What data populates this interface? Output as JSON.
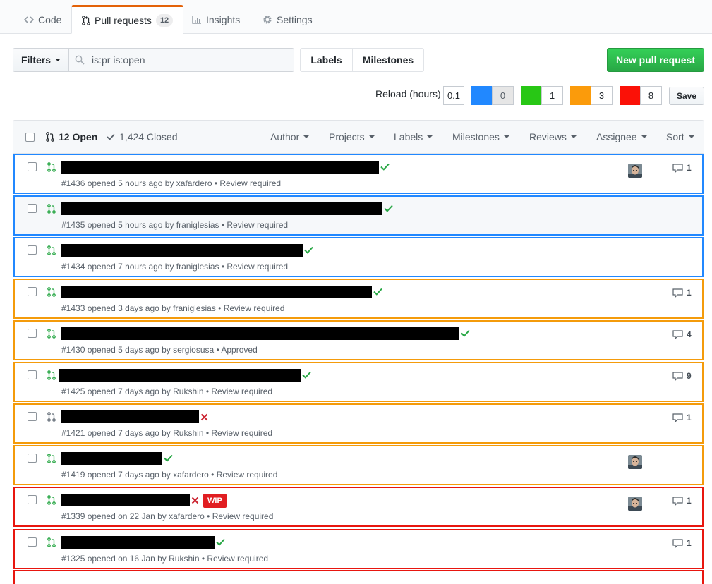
{
  "tabs": [
    {
      "label": "Code",
      "icon": "code-icon"
    },
    {
      "label": "Pull requests",
      "count": "12",
      "icon": "git-pull-request-icon",
      "selected": true
    },
    {
      "label": "Insights",
      "icon": "graph-icon"
    },
    {
      "label": "Settings",
      "icon": "gear-icon"
    }
  ],
  "filter_bar": {
    "filters_label": "Filters",
    "search_value": "is:pr is:open",
    "labels_label": "Labels",
    "milestones_label": "Milestones",
    "new_pr_label": "New pull request"
  },
  "reload": {
    "label": "Reload (hours)",
    "value": "0.1",
    "thresholds": [
      {
        "color": "#2188ff",
        "value": "0"
      },
      {
        "color": "#28c715",
        "value": "1"
      },
      {
        "color": "#fb9b0b",
        "value": "3"
      },
      {
        "color": "#fb1107",
        "value": "8"
      }
    ],
    "save_label": "Save"
  },
  "list_header": {
    "open_label": "12 Open",
    "closed_label": "1,424 Closed",
    "menus": [
      "Author",
      "Projects",
      "Labels",
      "Milestones",
      "Reviews",
      "Assignee",
      "Sort"
    ]
  },
  "pull_requests": [
    {
      "meta": "#1436 opened 5 hours ago by xafardero • Review required",
      "status": "success",
      "avatar": true,
      "comments": "1",
      "color": "blue"
    },
    {
      "meta": "#1435 opened 5 hours ago by franiglesias • Review required",
      "status": "success",
      "avatar": false,
      "comments": "",
      "color": "blue"
    },
    {
      "meta": "#1434 opened 7 hours ago by franiglesias • Review required",
      "status": "success",
      "avatar": false,
      "comments": "",
      "color": "blue"
    },
    {
      "meta": "#1433 opened 3 days ago by franiglesias • Review required",
      "status": "success",
      "avatar": false,
      "comments": "1",
      "color": "orange"
    },
    {
      "meta": "#1430 opened 5 days ago by sergiosusa • Approved",
      "status": "success",
      "avatar": false,
      "comments": "4",
      "color": "orange"
    },
    {
      "meta": "#1425 opened 7 days ago by Rukshin • Review required",
      "status": "success",
      "avatar": false,
      "comments": "9",
      "color": "orange"
    },
    {
      "meta": "#1421 opened 7 days ago by Rukshin • Review required",
      "status": "failure",
      "avatar": false,
      "comments": "1",
      "color": "orange"
    },
    {
      "meta": "#1419 opened 7 days ago by xafardero • Review required",
      "status": "success",
      "avatar": true,
      "comments": "",
      "color": "orange"
    },
    {
      "meta": "#1339 opened on 22 Jan by xafardero • Review required",
      "status": "failure",
      "label": "WIP",
      "avatar": true,
      "comments": "1",
      "color": "red"
    },
    {
      "meta": "#1325 opened on 16 Jan by Rukshin • Review required",
      "status": "success",
      "avatar": false,
      "comments": "1",
      "color": "red"
    }
  ]
}
